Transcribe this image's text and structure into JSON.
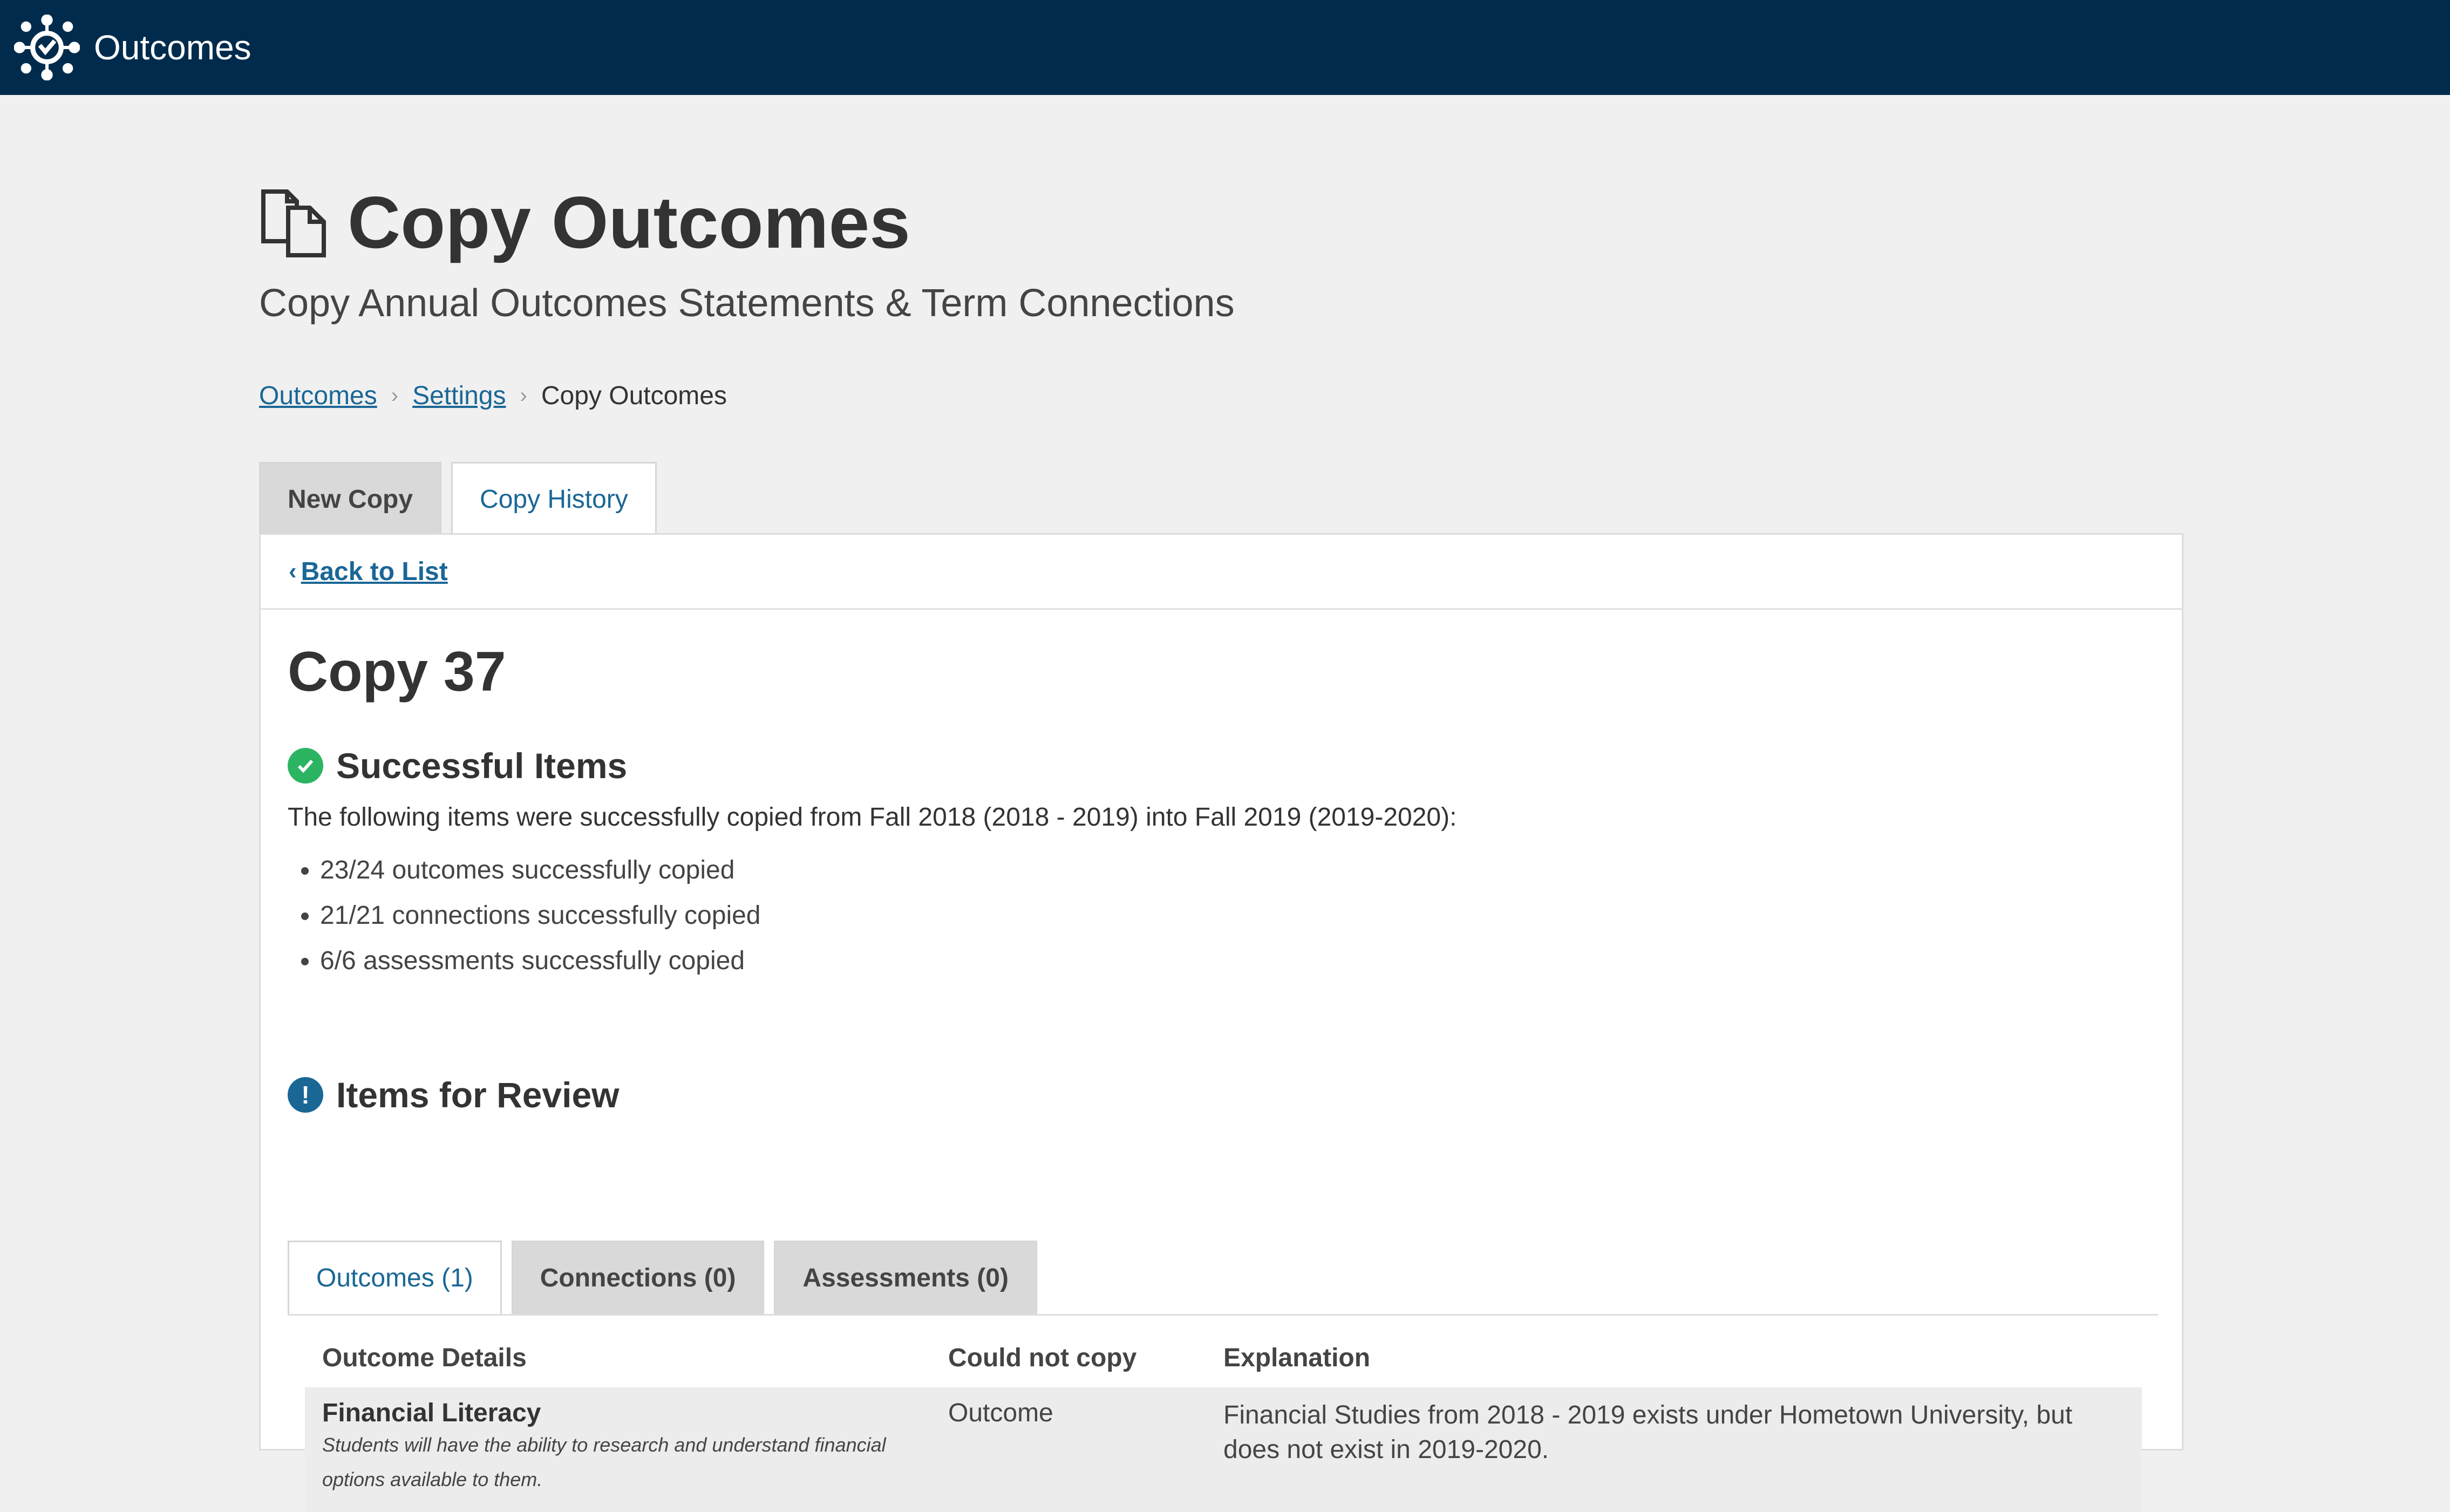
{
  "app": {
    "name": "Outcomes"
  },
  "header": {
    "title": "Copy Outcomes",
    "subtitle": "Copy Annual Outcomes Statements & Term Connections"
  },
  "breadcrumb": {
    "item1": "Outcomes",
    "item2": "Settings",
    "current": "Copy Outcomes"
  },
  "tabs": {
    "new_copy": "New Copy",
    "copy_history": "Copy History"
  },
  "panel": {
    "back_label": "Back to List",
    "copy_title": "Copy 37",
    "successful": {
      "heading": "Successful Items",
      "intro": "The following items were successfully copied from Fall 2018 (2018 - 2019) into Fall 2019 (2019-2020):",
      "items": [
        "23/24 outcomes successfully copied",
        "21/21 connections successfully copied",
        "6/6 assessments successfully copied"
      ]
    },
    "review": {
      "heading": "Items for Review",
      "tabs": [
        "Outcomes (1)",
        "Connections (0)",
        "Assessments (0)"
      ],
      "columns": [
        "Outcome Details",
        "Could not copy",
        "Explanation"
      ],
      "rows": [
        {
          "name": "Financial Literacy",
          "description": "Students will have the ability to research and understand financial options available to them.",
          "could_not_copy": "Outcome",
          "explanation": "Financial Studies from 2018 - 2019 exists under Hometown University, but does not exist in 2019-2020."
        }
      ]
    }
  },
  "colors": {
    "topbar": "#002b4c",
    "link": "#1a6796",
    "success": "#2bb462",
    "info": "#1a6796"
  },
  "icons": {
    "logo": "outcomes-network-icon",
    "copy": "copy-documents-icon",
    "back": "chevron-left-icon",
    "success": "check-circle-icon",
    "review": "exclamation-circle-icon",
    "breadcrumb_separator": "chevron-right-icon"
  }
}
